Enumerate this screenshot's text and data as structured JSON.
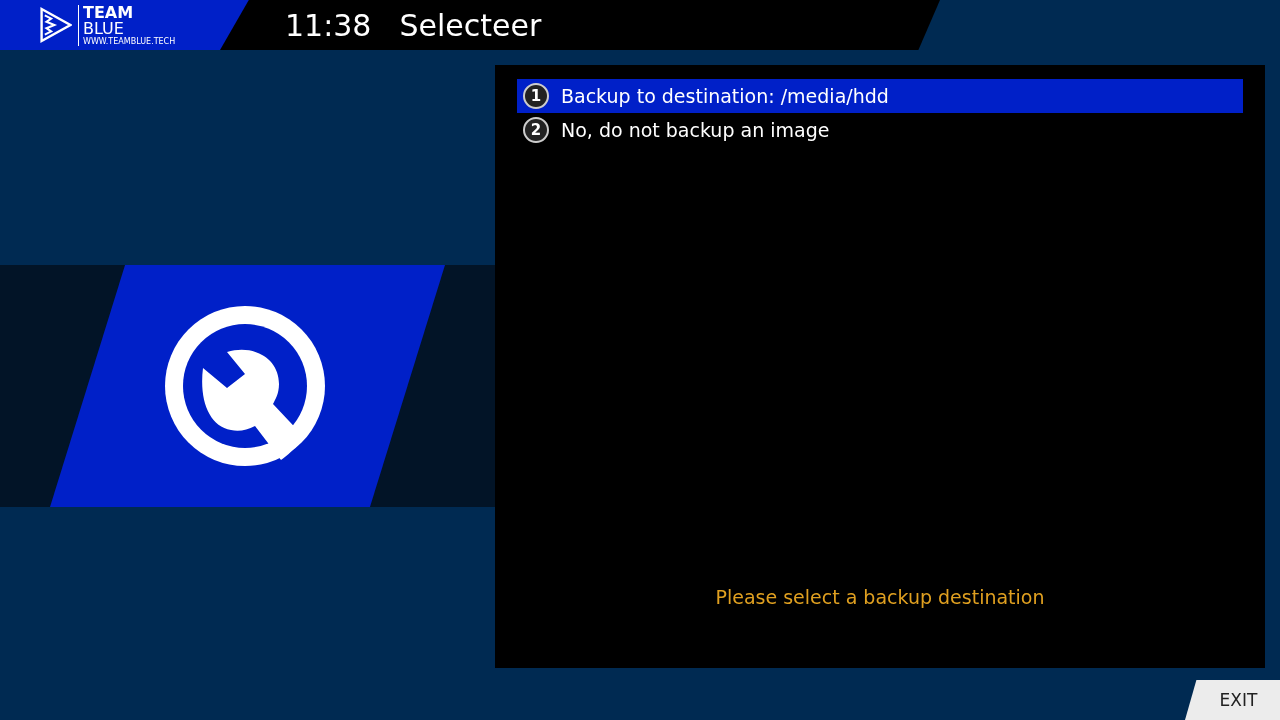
{
  "header": {
    "logo": {
      "line_1": "TEAM",
      "line_2": "BLUE",
      "url": "WWW.TEAMBLUE.TECH"
    },
    "clock": "11:38",
    "title": "Selecteer"
  },
  "menu": {
    "items": [
      {
        "number": "1",
        "label": "Backup to destination: /media/hdd",
        "selected": true
      },
      {
        "number": "2",
        "label": "No, do not backup an image",
        "selected": false
      }
    ]
  },
  "description": "Please select a backup destination",
  "buttons": [
    {
      "label": "EXIT"
    }
  ]
}
